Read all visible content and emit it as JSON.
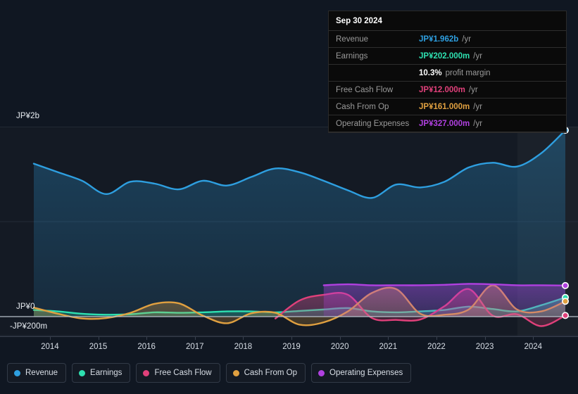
{
  "tooltip": {
    "date": "Sep 30 2024",
    "rows": [
      {
        "label": "Revenue",
        "value": "JP¥1.962b",
        "unit": "/yr",
        "color": "#2e9fe0"
      },
      {
        "label": "Earnings",
        "value": "JP¥202.000m",
        "unit": "/yr",
        "color": "#2ee0b0"
      },
      {
        "label": "",
        "value": "10.3%",
        "unit": "profit margin",
        "color": "#ffffff"
      },
      {
        "label": "Free Cash Flow",
        "value": "JP¥12.000m",
        "unit": "/yr",
        "color": "#e0407a"
      },
      {
        "label": "Cash From Op",
        "value": "JP¥161.000m",
        "unit": "/yr",
        "color": "#e0a040"
      },
      {
        "label": "Operating Expenses",
        "value": "JP¥327.000m",
        "unit": "/yr",
        "color": "#b040e0"
      }
    ]
  },
  "axes": {
    "y_top_label": "JP¥2b",
    "y_zero_label": "JP¥0",
    "y_bottom_label": "-JP¥200m",
    "x_ticks": [
      "2014",
      "2015",
      "2016",
      "2017",
      "2018",
      "2019",
      "2020",
      "2021",
      "2022",
      "2023",
      "2024"
    ]
  },
  "legend": [
    {
      "label": "Revenue",
      "color": "#2e9fe0"
    },
    {
      "label": "Earnings",
      "color": "#2ee0b0"
    },
    {
      "label": "Free Cash Flow",
      "color": "#e0407a"
    },
    {
      "label": "Cash From Op",
      "color": "#e0a040"
    },
    {
      "label": "Operating Expenses",
      "color": "#b040e0"
    }
  ],
  "chart_data": {
    "type": "area",
    "title": "",
    "xlabel": "",
    "ylabel": "",
    "ylim": [
      -200,
      2000
    ],
    "y_unit": "JP¥ millions",
    "x_range": [
      "2013-09",
      "2024-09"
    ],
    "grid": true,
    "legend_position": "bottom",
    "gridlines_y": [
      2000,
      1000,
      0,
      -200
    ],
    "highlight_region_start": "2023-10",
    "series": [
      {
        "name": "Revenue",
        "color": "#2e9fe0",
        "filled": true,
        "x": [
          "2013-09",
          "2014-03",
          "2014-09",
          "2015-03",
          "2015-09",
          "2016-03",
          "2016-09",
          "2017-03",
          "2017-09",
          "2018-03",
          "2018-09",
          "2019-03",
          "2019-09",
          "2020-03",
          "2020-09",
          "2021-03",
          "2021-09",
          "2022-03",
          "2022-09",
          "2023-03",
          "2023-09",
          "2024-03",
          "2024-09"
        ],
        "values": [
          1610,
          1520,
          1430,
          1290,
          1420,
          1400,
          1340,
          1430,
          1380,
          1470,
          1560,
          1520,
          1430,
          1330,
          1250,
          1390,
          1360,
          1420,
          1570,
          1620,
          1580,
          1720,
          1962
        ]
      },
      {
        "name": "Earnings",
        "color": "#2ee0b0",
        "filled": true,
        "x": [
          "2013-09",
          "2014-03",
          "2014-09",
          "2015-03",
          "2015-09",
          "2016-03",
          "2016-09",
          "2017-03",
          "2017-09",
          "2018-03",
          "2018-09",
          "2019-03",
          "2019-09",
          "2020-03",
          "2020-09",
          "2021-03",
          "2021-09",
          "2022-03",
          "2022-09",
          "2023-03",
          "2023-09",
          "2024-03",
          "2024-09"
        ],
        "values": [
          70,
          55,
          30,
          20,
          25,
          45,
          40,
          45,
          55,
          55,
          45,
          60,
          75,
          90,
          55,
          45,
          55,
          70,
          105,
          80,
          55,
          120,
          202
        ]
      },
      {
        "name": "Free Cash Flow",
        "color": "#e0407a",
        "filled": true,
        "x": [
          "2018-09",
          "2019-03",
          "2019-09",
          "2020-03",
          "2020-09",
          "2021-03",
          "2021-09",
          "2022-03",
          "2022-09",
          "2023-03",
          "2023-09",
          "2024-03",
          "2024-09"
        ],
        "values": [
          -20,
          170,
          230,
          230,
          -15,
          -35,
          -30,
          110,
          290,
          10,
          25,
          -100,
          12
        ]
      },
      {
        "name": "Cash From Op",
        "color": "#e0a040",
        "filled": true,
        "x": [
          "2013-09",
          "2014-03",
          "2014-09",
          "2015-03",
          "2015-09",
          "2016-03",
          "2016-09",
          "2017-03",
          "2017-09",
          "2018-03",
          "2018-09",
          "2019-03",
          "2019-09",
          "2020-03",
          "2020-09",
          "2021-03",
          "2021-09",
          "2022-03",
          "2022-09",
          "2023-03",
          "2023-09",
          "2024-03",
          "2024-09"
        ],
        "values": [
          95,
          30,
          -20,
          -15,
          40,
          135,
          140,
          10,
          -70,
          35,
          40,
          -85,
          -60,
          55,
          250,
          290,
          30,
          20,
          75,
          330,
          75,
          55,
          161
        ]
      },
      {
        "name": "Operating Expenses",
        "color": "#b040e0",
        "filled": true,
        "x": [
          "2019-09",
          "2020-03",
          "2020-09",
          "2021-03",
          "2021-09",
          "2022-03",
          "2022-09",
          "2023-03",
          "2023-09",
          "2024-03",
          "2024-09"
        ],
        "values": [
          330,
          340,
          330,
          330,
          330,
          335,
          345,
          340,
          330,
          330,
          327
        ]
      }
    ]
  }
}
